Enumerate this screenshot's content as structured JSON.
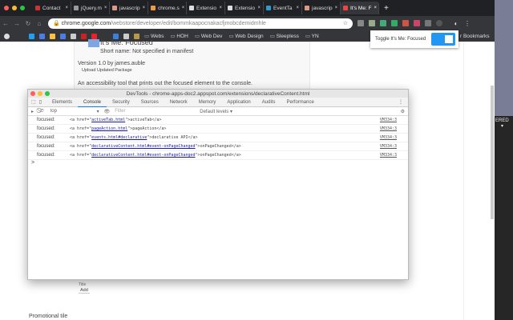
{
  "tabs": [
    {
      "label": "Contact",
      "color": "#c33"
    },
    {
      "label": "jQuery.m",
      "color": "#999"
    },
    {
      "label": "javascrip",
      "color": "#d98"
    },
    {
      "label": "chrome.s",
      "color": "#e94"
    },
    {
      "label": "Extensio",
      "color": "#ddd"
    },
    {
      "label": "Extensio",
      "color": "#ddd"
    },
    {
      "label": "EventTa",
      "color": "#39c"
    },
    {
      "label": "javascrip",
      "color": "#d98"
    },
    {
      "label": "It's Me: F",
      "color": "#e44"
    }
  ],
  "address": {
    "host": "chrome.google.com",
    "path": "/webstore/developer/edit/bommkaapocnakacfjmobcdemidmhle"
  },
  "bookmarks": {
    "folders": [
      "Webs",
      "HOH",
      "Web Dev",
      "Web Design",
      "Sleepless",
      "YN"
    ],
    "other": "r Bookmarks"
  },
  "popup": {
    "label": "Toggle It's Me: Focused",
    "toggle_on": true
  },
  "page": {
    "title": "It's Me: Focused",
    "short_name": "Short name: Not specified in manifest",
    "version": "Version 1.0 by james.auble",
    "upload": "Upload Updated Package",
    "description": "An accessibility tool that prints out the focused element to the console.",
    "field_hint": "Title",
    "add": "Add",
    "promo": "Promotional tile"
  },
  "devtools": {
    "title": "DevTools - chrome-apps-doc2.appspot.com/extensions/declarativeContent.html",
    "tabs": [
      "Elements",
      "Console",
      "Security",
      "Sources",
      "Network",
      "Memory",
      "Application",
      "Audits",
      "Performance"
    ],
    "active_tab": "Console",
    "context": "top",
    "filter_placeholder": "Filter",
    "levels": "Default levels ▾",
    "rows": [
      {
        "label": "focused:",
        "pre": "<a href=\"",
        "link": "activeTab.html",
        "post": "\">activeTab</a>",
        "src": "VM334:3"
      },
      {
        "label": "focused:",
        "pre": "<a href=\"",
        "link": "pageAction.html",
        "post": "\">pageAction</a>",
        "src": "VM334:3"
      },
      {
        "label": "focused:",
        "pre": "<a href=\"",
        "link": "events.html#declarative",
        "post": "\">declarative API</a>",
        "src": "VM334:3"
      },
      {
        "label": "focused:",
        "pre": "<a href=\"",
        "link": "declarativeContent.html#event-onPageChanged",
        "post": "\">onPageChanged</a>",
        "src": "VM334:3"
      },
      {
        "label": "focused:",
        "pre": "<a href=\"",
        "link": "declarativeContent.html#event-onPageChanged",
        "post": "\">onPageChanged</a>",
        "src": "VM334:3"
      }
    ],
    "prompt": ">"
  },
  "desktop_panel": {
    "label": "ERED"
  }
}
